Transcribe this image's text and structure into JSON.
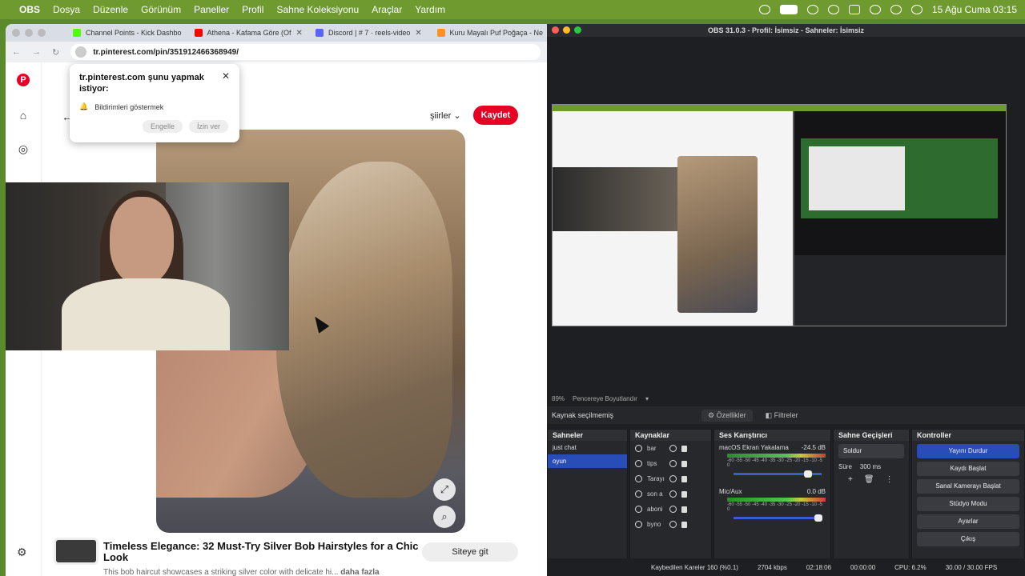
{
  "menubar": {
    "app": "OBS",
    "items": [
      "Dosya",
      "Düzenle",
      "Görünüm",
      "Paneller",
      "Profil",
      "Sahne Koleksiyonu",
      "Araçlar",
      "Yardım"
    ],
    "clock": "15 Ağu Cuma 03:15"
  },
  "browser": {
    "tabs": [
      {
        "title": "Channel Points - Kick Dashbo",
        "color": "#53fc18"
      },
      {
        "title": "Athena - Kafama Göre (Of",
        "color": "#ff0000"
      },
      {
        "title": "Discord | # 7 · reels-video",
        "color": "#5865f2"
      },
      {
        "title": "Kuru Mayalı Puf Poğaça - Ne",
        "color": "#f7931e"
      }
    ],
    "url": "tr.pinterest.com/pin/351912466368949/",
    "logo": "P",
    "board": "şiirler",
    "save": "Kaydet",
    "notification": {
      "title": "tr.pinterest.com şunu yapmak istiyor:",
      "item": "Bildirimleri göstermek",
      "block": "Engelle",
      "allow": "İzin ver"
    },
    "pin_title": "Timeless Elegance: 32 Must-Try Silver Bob Hairstyles for a Chic Look",
    "pin_desc": "This bob haircut showcases a striking silver color with delicate hi...",
    "more": "daha fazla",
    "visit": "Siteye git"
  },
  "obs": {
    "title": "OBS 31.0.3 - Profil: İsimsiz - Sahneler: İsimsiz",
    "zoom": "89%",
    "fit": "Pencereye Boyutlandır",
    "no_source": "Kaynak seçilmemiş",
    "properties": "Özellikler",
    "filters": "Filtreler",
    "scenes_title": "Sahneler",
    "scenes": [
      {
        "name": "just chat",
        "active": false
      },
      {
        "name": "oyun",
        "active": true
      }
    ],
    "sources_title": "Kaynaklar",
    "sources": [
      "bar",
      "tips",
      "Tarayı",
      "son a",
      "aboni",
      "byno"
    ],
    "mixer_title": "Ses Karıştırıcı",
    "channels": [
      {
        "name": "macOS Ekran Yakalama",
        "db": "-24.5 dB",
        "level": 0.8
      },
      {
        "name": "Mic/Aux",
        "db": "0.0 dB",
        "level": 1.0
      }
    ],
    "meter_scale": "-60 -55 -50 -45 -40 -35 -30 -25 -20 -15 -10 -5 0",
    "transitions_title": "Sahne Geçişleri",
    "transition": "Soldur",
    "duration_label": "Süre",
    "duration": "300 ms",
    "controls_title": "Kontroller",
    "controls": [
      "Yayını Durdur",
      "Kaydı Başlat",
      "Sanal Kamerayı Başlat",
      "Stüdyo Modu",
      "Ayarlar",
      "Çıkış"
    ],
    "status": {
      "dropped": "Kaybedilen Kareler 160 (%0.1)",
      "bitrate": "2704 kbps",
      "stream_time": "02:18:06",
      "rec_time": "00:00:00",
      "cpu": "CPU: 6.2%",
      "fps": "30.00 / 30.00 FPS"
    }
  }
}
